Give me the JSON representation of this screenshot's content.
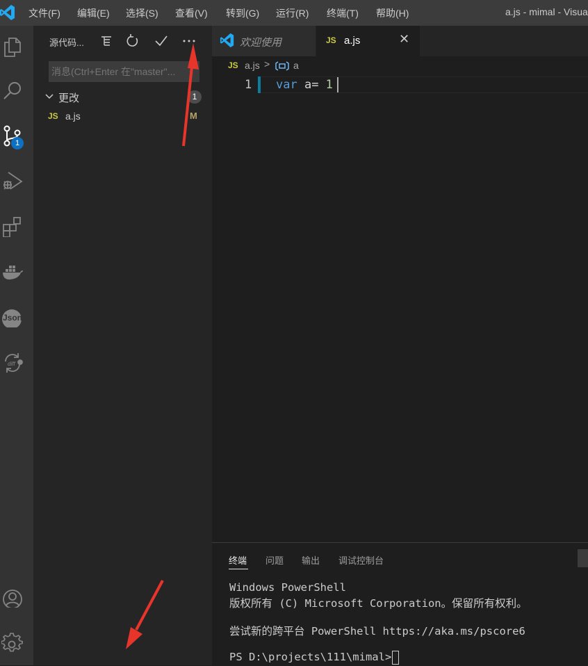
{
  "titlebar": {
    "menus": [
      "文件(F)",
      "编辑(E)",
      "选择(S)",
      "查看(V)",
      "转到(G)",
      "运行(R)",
      "终端(T)",
      "帮助(H)"
    ],
    "window_title": "a.js - mimal - Visua"
  },
  "activity_bar": {
    "scm_badge": "1",
    "icons": [
      "explorer-icon",
      "search-icon",
      "source-control-icon",
      "run-debug-icon",
      "extensions-icon",
      "docker-icon",
      "json-icon",
      "git-diff-icon",
      "account-icon",
      "settings-gear-icon"
    ],
    "json_label": "Json"
  },
  "scm": {
    "title": "源代码...",
    "commit_placeholder": "消息(Ctrl+Enter 在\"master\"...",
    "changes_label": "更改",
    "changes_count": "1",
    "files": [
      {
        "lang_badge": "JS",
        "name": "a.js",
        "status": "M"
      }
    ]
  },
  "editor": {
    "tabs": [
      {
        "label": "欢迎使用",
        "italic": true,
        "active": false
      },
      {
        "lang_badge": "JS",
        "label": "a.js",
        "active": true,
        "close": "✕"
      }
    ],
    "breadcrumb": {
      "lang_badge": "JS",
      "file": "a.js",
      "separator": ">",
      "symbol": "a"
    },
    "lines": [
      {
        "number": "1",
        "keyword": "var",
        "rest": " a= ",
        "value": "1"
      }
    ]
  },
  "panel": {
    "tabs": [
      "终端",
      "问题",
      "输出",
      "调试控制台"
    ],
    "active_tab": "终端",
    "terminal_lines": [
      "Windows PowerShell",
      "版权所有 (C) Microsoft Corporation。保留所有权利。",
      "",
      "尝试新的跨平台 PowerShell https://aka.ms/pscore6",
      "",
      "PS D:\\projects\\111\\mimal> "
    ]
  },
  "colors": {
    "accent_blue": "#0e70c0",
    "js_yellow": "#cbcb41",
    "modified": "#b8a26a",
    "annotation_red": "#e8352b"
  }
}
